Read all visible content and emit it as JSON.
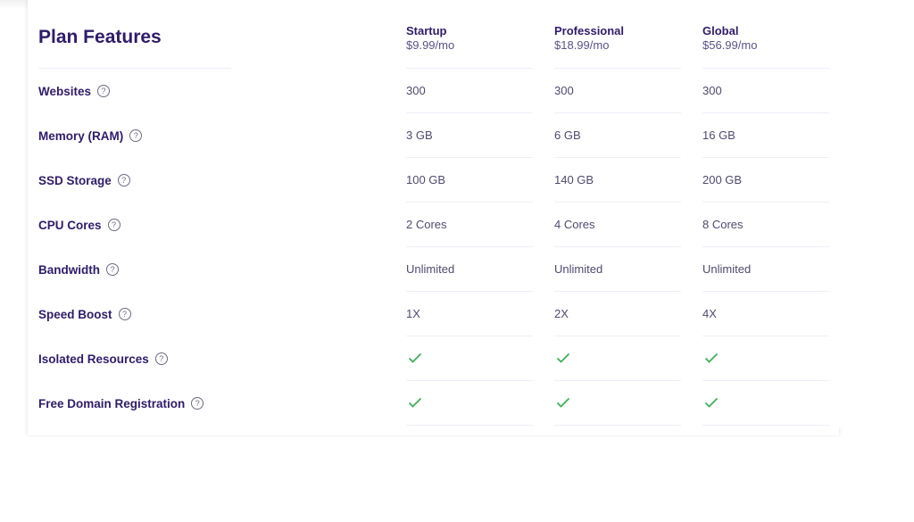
{
  "table": {
    "title": "Plan Features",
    "plans": [
      {
        "name": "Startup",
        "price": "$9.99/mo"
      },
      {
        "name": "Professional",
        "price": "$18.99/mo"
      },
      {
        "name": "Global",
        "price": "$56.99/mo"
      }
    ],
    "features": [
      {
        "label": "Websites",
        "values": [
          "300",
          "300",
          "300"
        ]
      },
      {
        "label": "Memory (RAM)",
        "values": [
          "3 GB",
          "6 GB",
          "16 GB"
        ]
      },
      {
        "label": "SSD Storage",
        "values": [
          "100 GB",
          "140 GB",
          "200 GB"
        ]
      },
      {
        "label": "CPU Cores",
        "values": [
          "2 Cores",
          "4 Cores",
          "8 Cores"
        ]
      },
      {
        "label": "Bandwidth",
        "values": [
          "Unlimited",
          "Unlimited",
          "Unlimited"
        ]
      },
      {
        "label": "Speed Boost",
        "values": [
          "1X",
          "2X",
          "4X"
        ]
      },
      {
        "label": "Isolated Resources",
        "values": [
          true,
          true,
          true
        ]
      },
      {
        "label": "Free Domain Registration",
        "values": [
          true,
          true,
          true
        ]
      }
    ],
    "help_icon_glyph": "?",
    "colors": {
      "heading": "#2f1c6a",
      "check": "#3fae5a",
      "text": "#4f4a6e"
    }
  }
}
